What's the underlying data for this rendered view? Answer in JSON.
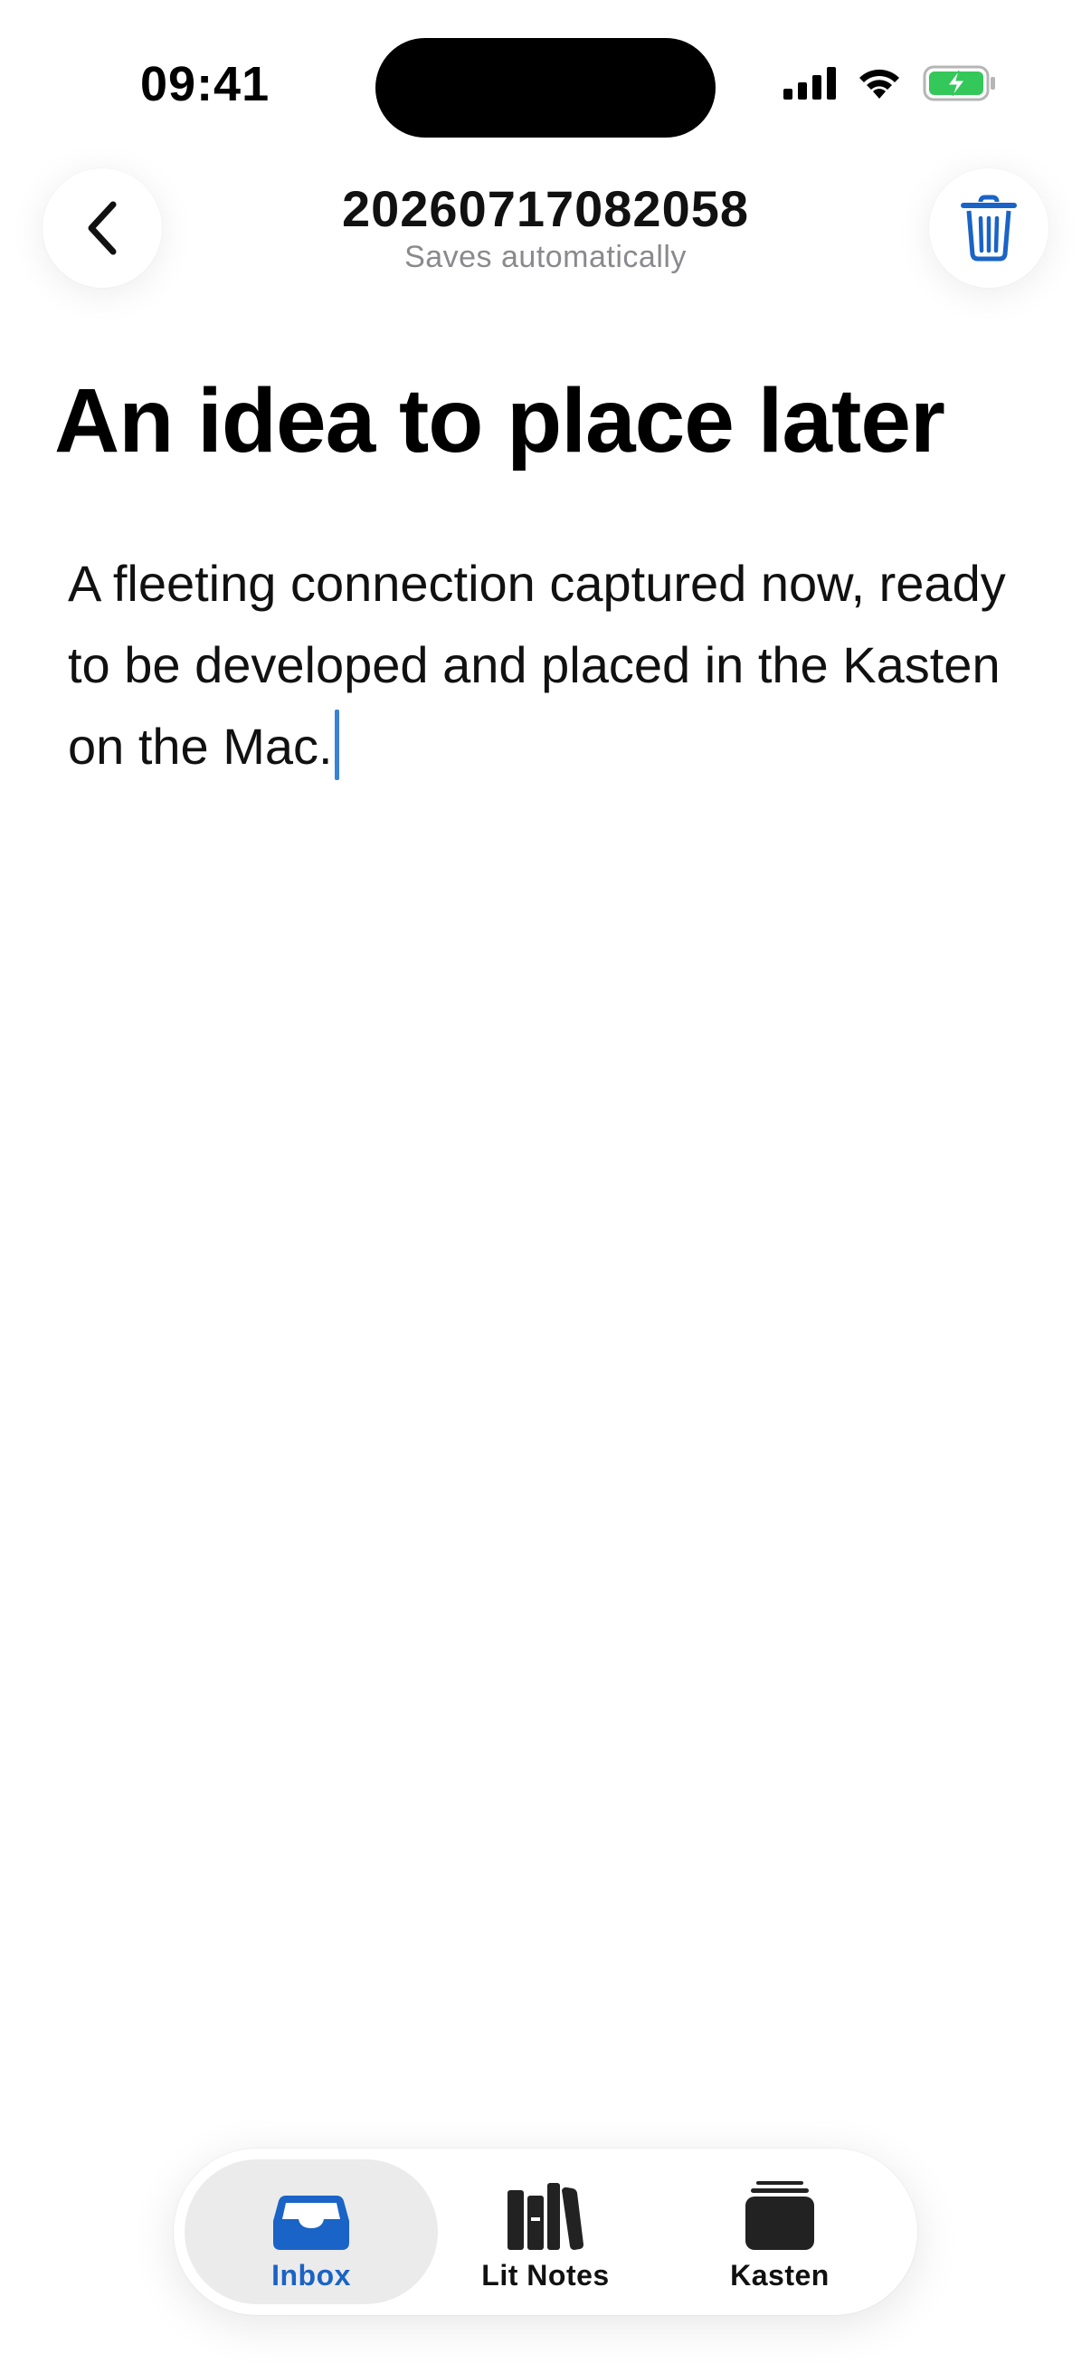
{
  "status_bar": {
    "time": "09:41",
    "icons": [
      "cellular-signal-icon",
      "wifi-icon",
      "battery-charging-icon"
    ]
  },
  "header": {
    "back_icon": "chevron-left-icon",
    "title": "20260717082058",
    "subtitle": "Saves automatically",
    "trash_icon": "trash-icon"
  },
  "note": {
    "title": "An idea to place later",
    "body": "A fleeting connection captured now, ready to be developed and placed in the Kasten on the Mac."
  },
  "tabbar": {
    "items": [
      {
        "label": "Inbox",
        "icon": "inbox-tray-icon",
        "selected": true
      },
      {
        "label": "Lit Notes",
        "icon": "books-icon",
        "selected": false
      },
      {
        "label": "Kasten",
        "icon": "card-stack-icon",
        "selected": false
      }
    ]
  },
  "colors": {
    "accent": "#1a63c7",
    "caret": "#3a82d6",
    "battery_green": "#34c759",
    "secondary_text": "#8a8a8e"
  }
}
